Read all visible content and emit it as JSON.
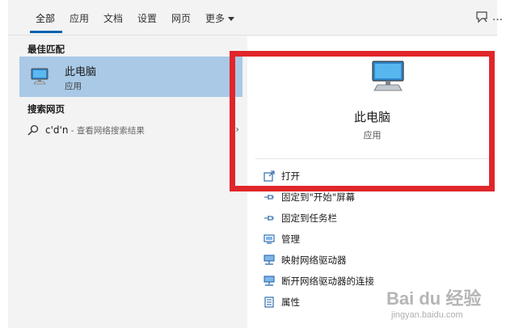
{
  "tabs": [
    {
      "label": "全部",
      "active": true
    },
    {
      "label": "应用"
    },
    {
      "label": "文档"
    },
    {
      "label": "设置"
    },
    {
      "label": "网页"
    },
    {
      "label": "更多"
    }
  ],
  "accent_color": "#0063b1",
  "best_match": {
    "heading": "最佳匹配",
    "title": "此电脑",
    "subtitle": "应用",
    "icon": "computer-icon"
  },
  "web_search": {
    "heading": "搜索网页",
    "query": "c'd'n",
    "suffix": " - 查看网络搜索结果"
  },
  "detail": {
    "title": "此电脑",
    "subtitle": "应用",
    "actions": [
      {
        "label": "打开",
        "icon": "open-icon"
      },
      {
        "label": "固定到\"开始\"屏幕",
        "icon": "pin-icon"
      },
      {
        "label": "固定到任务栏",
        "icon": "pin-icon"
      },
      {
        "label": "管理",
        "icon": "manage-icon"
      },
      {
        "label": "映射网络驱动器",
        "icon": "network-drive-icon"
      },
      {
        "label": "断开网络驱动器的连接",
        "icon": "network-drive-icon"
      },
      {
        "label": "属性",
        "icon": "properties-icon"
      }
    ]
  },
  "highlight_color": "#e0262a",
  "watermark": {
    "text": "Bai du 经验",
    "url": "jingyan.baidu.com"
  }
}
